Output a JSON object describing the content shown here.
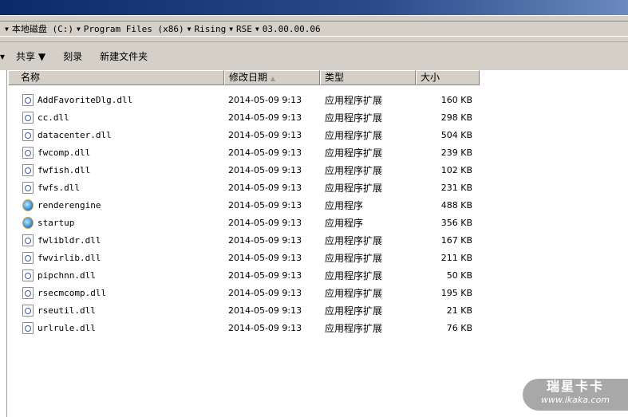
{
  "breadcrumb": [
    "本地磁盘 (C:)",
    "Program Files (x86)",
    "Rising",
    "RSE",
    "03.00.00.06"
  ],
  "toolbar": {
    "share": "共享 ▼",
    "burn": "刻录",
    "new_folder": "新建文件夹"
  },
  "columns": {
    "name": "名称",
    "date": "修改日期",
    "type": "类型",
    "size": "大小"
  },
  "files": [
    {
      "name": "AddFavoriteDlg.dll",
      "date": "2014-05-09 9:13",
      "type": "应用程序扩展",
      "size": "160 KB",
      "icon": "dll"
    },
    {
      "name": "cc.dll",
      "date": "2014-05-09 9:13",
      "type": "应用程序扩展",
      "size": "298 KB",
      "icon": "dll"
    },
    {
      "name": "datacenter.dll",
      "date": "2014-05-09 9:13",
      "type": "应用程序扩展",
      "size": "504 KB",
      "icon": "dll"
    },
    {
      "name": "fwcomp.dll",
      "date": "2014-05-09 9:13",
      "type": "应用程序扩展",
      "size": "239 KB",
      "icon": "dll"
    },
    {
      "name": "fwfish.dll",
      "date": "2014-05-09 9:13",
      "type": "应用程序扩展",
      "size": "102 KB",
      "icon": "dll"
    },
    {
      "name": "fwfs.dll",
      "date": "2014-05-09 9:13",
      "type": "应用程序扩展",
      "size": "231 KB",
      "icon": "dll"
    },
    {
      "name": "renderengine",
      "date": "2014-05-09 9:13",
      "type": "应用程序",
      "size": "488 KB",
      "icon": "ie"
    },
    {
      "name": "startup",
      "date": "2014-05-09 9:13",
      "type": "应用程序",
      "size": "356 KB",
      "icon": "ie"
    },
    {
      "name": "fwlibldr.dll",
      "date": "2014-05-09 9:13",
      "type": "应用程序扩展",
      "size": "167 KB",
      "icon": "dll"
    },
    {
      "name": "fwvirlib.dll",
      "date": "2014-05-09 9:13",
      "type": "应用程序扩展",
      "size": "211 KB",
      "icon": "dll"
    },
    {
      "name": "pipchnn.dll",
      "date": "2014-05-09 9:13",
      "type": "应用程序扩展",
      "size": "50 KB",
      "icon": "dll"
    },
    {
      "name": "rsecmcomp.dll",
      "date": "2014-05-09 9:13",
      "type": "应用程序扩展",
      "size": "195 KB",
      "icon": "dll"
    },
    {
      "name": "rseutil.dll",
      "date": "2014-05-09 9:13",
      "type": "应用程序扩展",
      "size": "21 KB",
      "icon": "dll"
    },
    {
      "name": "urlrule.dll",
      "date": "2014-05-09 9:13",
      "type": "应用程序扩展",
      "size": "76 KB",
      "icon": "dll"
    }
  ],
  "watermark": {
    "brand": "瑞星卡卡",
    "url": "www.ikaka.com"
  }
}
